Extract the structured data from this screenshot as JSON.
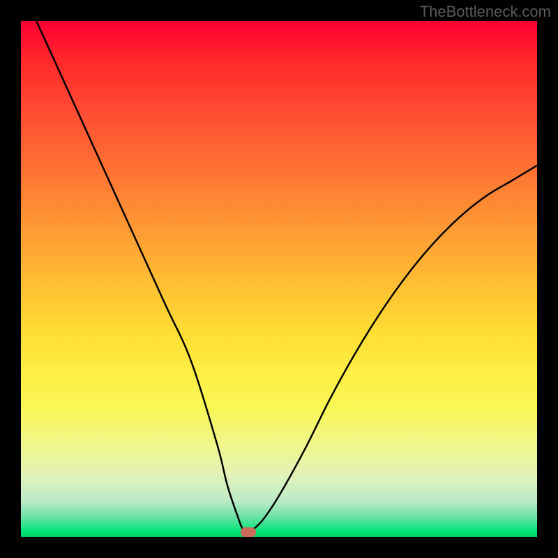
{
  "watermark": "TheBottleneck.com",
  "chart_data": {
    "type": "line",
    "title": "",
    "xlabel": "",
    "ylabel": "",
    "xlim": [
      0,
      100
    ],
    "ylim": [
      0,
      100
    ],
    "x": [
      3,
      8,
      13,
      18,
      23,
      28,
      33,
      38,
      40,
      42,
      43,
      44,
      45,
      47,
      50,
      55,
      60,
      65,
      70,
      75,
      80,
      85,
      90,
      95,
      100
    ],
    "values": [
      100,
      89,
      78,
      67,
      56,
      45,
      34,
      18,
      10,
      4,
      1.5,
      1,
      1.5,
      3.5,
      8,
      17,
      27,
      36,
      44,
      51,
      57,
      62,
      66,
      69,
      72
    ],
    "marker": {
      "x": 44,
      "y": 1
    },
    "background_gradient": {
      "top": "#ff0033",
      "bottom": "#00d060"
    }
  }
}
